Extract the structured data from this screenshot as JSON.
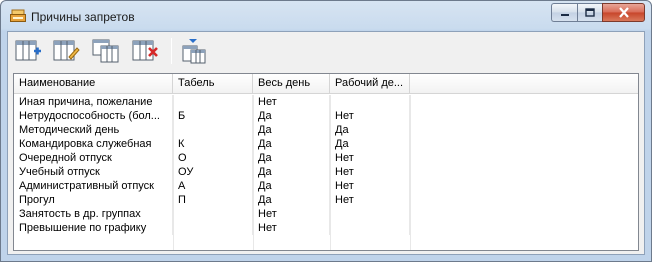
{
  "window": {
    "title": "Причины запретов",
    "controls": {
      "minimize": "minimize",
      "maximize": "maximize",
      "close": "close"
    }
  },
  "toolbar": {
    "buttons": [
      {
        "name": "add-row",
        "icon": "table-add-icon"
      },
      {
        "name": "edit-row",
        "icon": "table-edit-icon"
      },
      {
        "name": "copy-row",
        "icon": "table-copy-icon"
      },
      {
        "name": "delete-row",
        "icon": "table-delete-icon"
      },
      {
        "name": "column-settings",
        "icon": "column-settings-icon"
      }
    ]
  },
  "table": {
    "columns": [
      "Наименование",
      "Табель",
      "Весь день",
      "Рабочий де..."
    ],
    "rows": [
      [
        "Иная причина, пожелание",
        "",
        "Нет",
        ""
      ],
      [
        "Нетрудоспособность (бол...",
        "Б",
        "Да",
        "Нет"
      ],
      [
        "Методический день",
        "",
        "Да",
        "Да"
      ],
      [
        "Командировка служебная",
        "К",
        "Да",
        "Да"
      ],
      [
        "Очередной отпуск",
        "О",
        "Да",
        "Нет"
      ],
      [
        "Учебный отпуск",
        "ОУ",
        "Да",
        "Нет"
      ],
      [
        "Административный отпуск",
        "А",
        "Да",
        "Нет"
      ],
      [
        "Прогул",
        "П",
        "Да",
        "Нет"
      ],
      [
        "Занятость в др. группах",
        "",
        "Нет",
        ""
      ],
      [
        "Превышение по графику",
        "",
        "Нет",
        ""
      ]
    ]
  },
  "colors": {
    "accent": "#2a6fc9",
    "delete": "#d62828",
    "close": "#c7452a"
  }
}
